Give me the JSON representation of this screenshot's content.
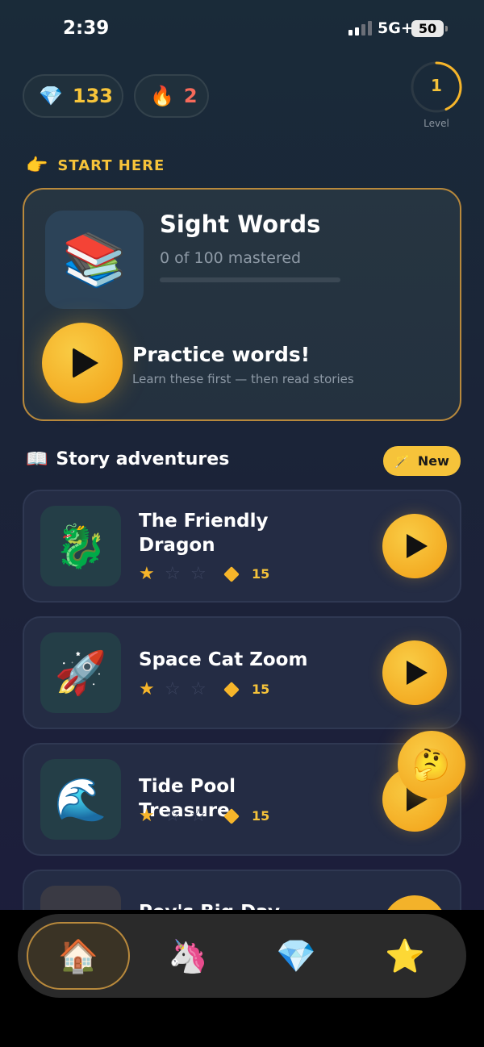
{
  "status_bar": {
    "time": "2:39",
    "network": "5G+",
    "battery": "50"
  },
  "stats": {
    "gems": {
      "icon": "💎",
      "value": "133"
    },
    "streak": {
      "icon": "🔥",
      "value": "2"
    },
    "level": {
      "value": "1",
      "label": "Level"
    }
  },
  "start_here": {
    "icon": "👉",
    "label": "START HERE"
  },
  "sight_words": {
    "icon": "📚",
    "title": "Sight Words",
    "progress_text": "0 of 100 mastered",
    "progress_fraction": 0,
    "practice_title": "Practice words!",
    "practice_subtitle": "Learn these first — then read stories"
  },
  "story_section": {
    "icon": "📖",
    "title": "Story adventures",
    "badge_icon": "🪄",
    "badge_label": "New"
  },
  "stories": [
    {
      "icon": "🐉",
      "title": "The Friendly Dragon",
      "stars": 1,
      "max_stars": 3,
      "gems": "15"
    },
    {
      "icon": "🚀",
      "title": "Space Cat Zoom",
      "stars": 1,
      "max_stars": 3,
      "gems": "15"
    },
    {
      "icon": "🌊",
      "title": "Tide Pool Treasure",
      "stars": 1,
      "max_stars": 3,
      "gems": "15"
    },
    {
      "icon": "",
      "title": "Pey's Big Day"
    }
  ],
  "help_button": {
    "icon": "🤔"
  },
  "tabbar": [
    {
      "icon": "🏠",
      "name": "home-icon",
      "active": true
    },
    {
      "icon": "🦄",
      "name": "unicorn-icon",
      "active": false
    },
    {
      "icon": "💎",
      "name": "gem-icon",
      "active": false
    },
    {
      "icon": "⭐",
      "name": "star-icon",
      "active": false
    }
  ],
  "colors": {
    "accent": "#f6c33a",
    "streak": "#f86a5a",
    "card": "#242c44",
    "highlight_border": "#b8893c"
  }
}
